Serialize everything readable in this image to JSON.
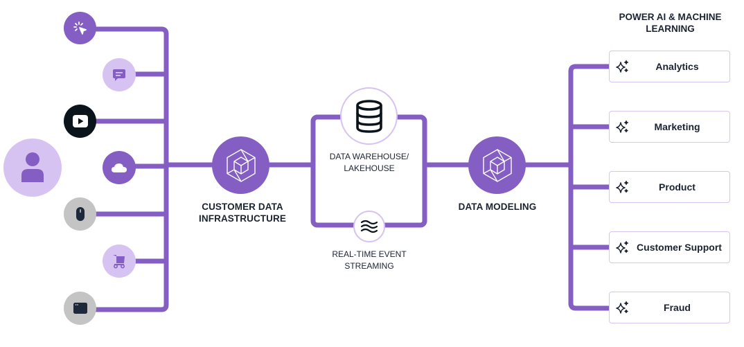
{
  "colors": {
    "accent": "#845ec2",
    "accent_light": "#d7c3f2",
    "dark": "#0b141b",
    "gray": "#c4c4c4",
    "icon_dark": "#1e293b",
    "card_border": "#d7c6f0"
  },
  "sources": [
    {
      "icon": "cursor-click-icon",
      "style": "accent"
    },
    {
      "icon": "chat-message-icon",
      "style": "light"
    },
    {
      "icon": "video-play-icon",
      "style": "dark"
    },
    {
      "icon": "cloud-icon",
      "style": "accent"
    },
    {
      "icon": "mouse-icon",
      "style": "gray"
    },
    {
      "icon": "shopping-cart-icon",
      "style": "light"
    },
    {
      "icon": "browser-window-icon",
      "style": "gray"
    }
  ],
  "user": {
    "icon": "user-icon"
  },
  "cdi": {
    "label_line1": "CUSTOMER DATA",
    "label_line2": "INFRASTRUCTURE",
    "icon": "hexagon-cube-icon"
  },
  "warehouse": {
    "label_line1": "DATA WAREHOUSE/",
    "label_line2": "LAKEHOUSE",
    "icon": "database-icon"
  },
  "streaming": {
    "label_line1": "REAL-TIME EVENT",
    "label_line2": "STREAMING",
    "icon": "waves-icon"
  },
  "modeling": {
    "label": "DATA MODELING",
    "icon": "hexagon-cube-icon"
  },
  "outputs": {
    "heading_line1": "POWER AI & MACHINE",
    "heading_line2": "LEARNING",
    "items": [
      {
        "label": "Analytics",
        "icon": "sparkles-icon"
      },
      {
        "label": "Marketing",
        "icon": "sparkles-icon"
      },
      {
        "label": "Product",
        "icon": "sparkles-icon"
      },
      {
        "label": "Customer Support",
        "icon": "sparkles-icon"
      },
      {
        "label": "Fraud",
        "icon": "sparkles-icon"
      }
    ]
  }
}
